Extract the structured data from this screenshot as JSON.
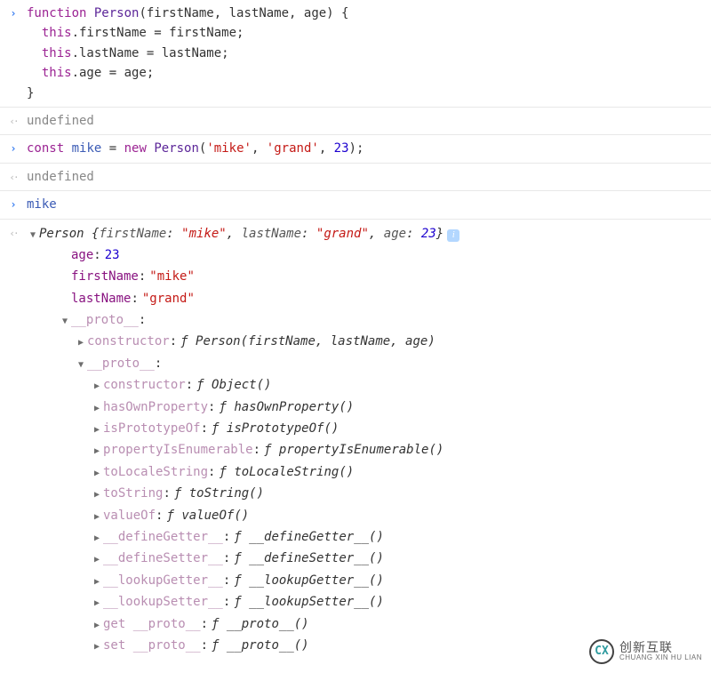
{
  "entries": {
    "code1_l1": "function",
    "code1_fn": "Person",
    "code1_params": "(firstName, lastName, age) {",
    "code1_l2a": "this",
    "code1_l2b": ".firstName = firstName;",
    "code1_l3a": "this",
    "code1_l3b": ".lastName = lastName;",
    "code1_l4a": "this",
    "code1_l4b": ".age = age;",
    "code1_l5": "}",
    "out1": "undefined",
    "code2_const": "const",
    "code2_var": "mike",
    "code2_eq": " = ",
    "code2_new": "new",
    "code2_fn": " Person",
    "code2_open": "(",
    "code2_s1": "'mike'",
    "code2_c1": ", ",
    "code2_s2": "'grand'",
    "code2_c2": ", ",
    "code2_n1": "23",
    "code2_close": ");",
    "out2": "undefined",
    "code3": "mike"
  },
  "preview": {
    "cls": "Person",
    "open": " {",
    "k1": "firstName",
    "v1": "\"mike\"",
    "k2": "lastName",
    "v2": "\"grand\"",
    "k3": "age",
    "v3": "23",
    "close": "}"
  },
  "tree": {
    "age_k": "age",
    "age_v": "23",
    "first_k": "firstName",
    "first_v": "\"mike\"",
    "last_k": "lastName",
    "last_v": "\"grand\"",
    "proto1": "__proto__",
    "ctor1_k": "constructor",
    "ctor1_f": "ƒ",
    "ctor1_v": "Person(firstName, lastName, age)",
    "proto2": "__proto__",
    "ctor2_k": "constructor",
    "ctor2_v": "Object()",
    "hop_k": "hasOwnProperty",
    "hop_v": "hasOwnProperty()",
    "ipo_k": "isPrototypeOf",
    "ipo_v": "isPrototypeOf()",
    "pie_k": "propertyIsEnumerable",
    "pie_v": "propertyIsEnumerable()",
    "tls_k": "toLocaleString",
    "tls_v": "toLocaleString()",
    "ts_k": "toString",
    "ts_v": "toString()",
    "vo_k": "valueOf",
    "vo_v": "valueOf()",
    "dg_k": "__defineGetter__",
    "dg_v": "__defineGetter__()",
    "ds_k": "__defineSetter__",
    "ds_v": "__defineSetter__()",
    "lg_k": "__lookupGetter__",
    "lg_v": "__lookupGetter__()",
    "ls_k": "__lookupSetter__",
    "ls_v": "__lookupSetter__()",
    "gp_k": "get __proto__",
    "gp_v": "__proto__()",
    "sp_k": "set __proto__",
    "sp_v": "__proto__()",
    "f": "ƒ",
    "colon": ":"
  },
  "watermark": {
    "logo": "CX",
    "zh": "创新互联",
    "py": "CHUANG XIN HU LIAN"
  }
}
